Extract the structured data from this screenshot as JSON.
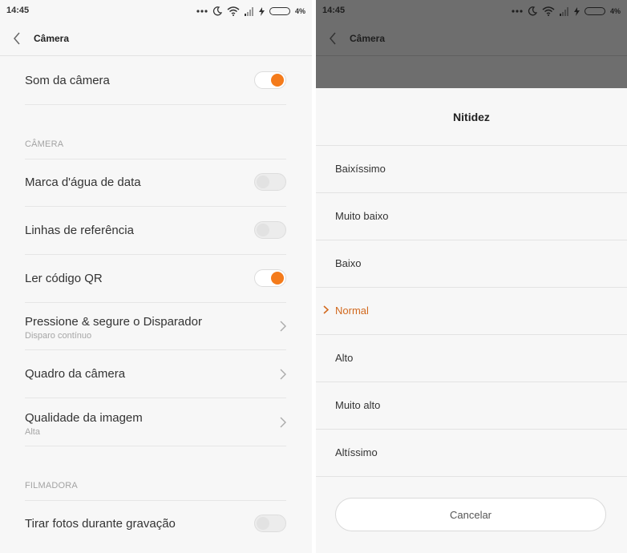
{
  "status_bar": {
    "time": "14:45",
    "battery": "4%"
  },
  "left": {
    "header": {
      "title": "Câmera"
    },
    "rows": [
      {
        "label": "Som da câmera",
        "toggle": true
      },
      {
        "label": "Marca d'água de data",
        "toggle": false
      },
      {
        "label": "Linhas de referência",
        "toggle": false
      },
      {
        "label": "Ler código QR",
        "toggle": true
      },
      {
        "label": "Pressione & segure o Disparador",
        "sub": "Disparo contínuo"
      },
      {
        "label": "Quadro da câmera"
      },
      {
        "label": "Qualidade da imagem",
        "sub": "Alta"
      },
      {
        "label": "Tirar fotos durante gravação",
        "toggle": false
      }
    ],
    "sections": {
      "camera": "CÂMERA",
      "video": "FILMADORA"
    }
  },
  "right": {
    "header": {
      "title": "Câmera"
    },
    "dialog": {
      "title": "Nitidez",
      "options": [
        "Baixíssimo",
        "Muito baixo",
        "Baixo",
        "Normal",
        "Alto",
        "Muito alto",
        "Altíssimo"
      ],
      "selected": "Normal",
      "cancel_label": "Cancelar"
    }
  },
  "colors": {
    "accent": "#f47b1b",
    "selected_text": "#d2691e",
    "overlay": "#6e6e6e"
  }
}
